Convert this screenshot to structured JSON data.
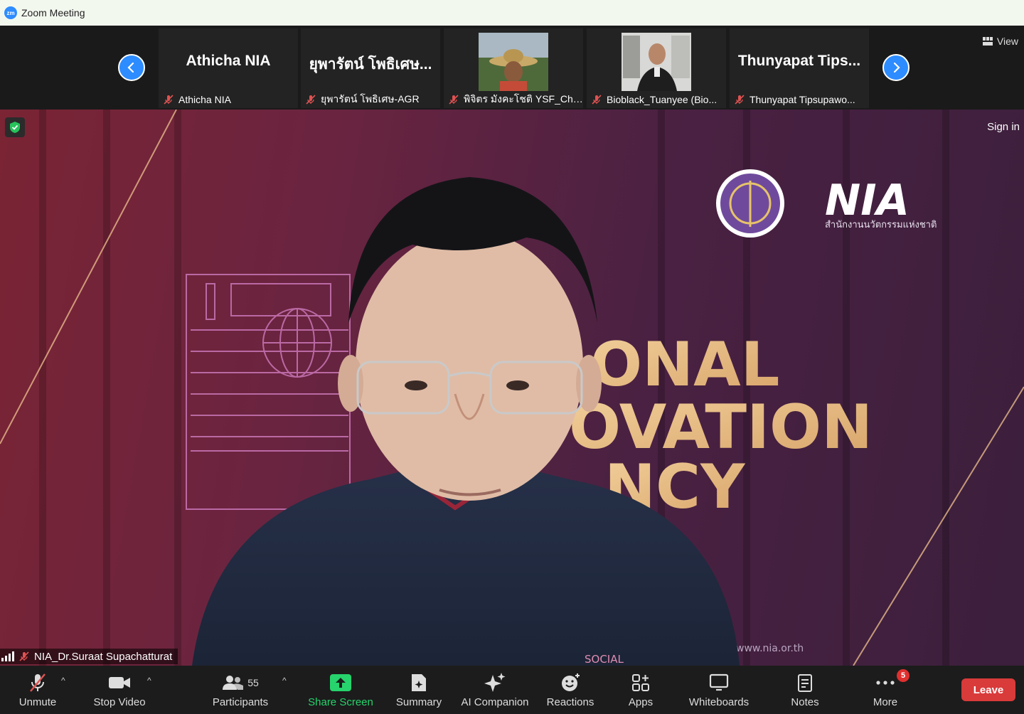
{
  "window": {
    "title": "Zoom Meeting",
    "logo_text": "zm"
  },
  "strip": {
    "view_label": "View",
    "tiles": [
      {
        "big_name": "Athicha NIA",
        "label": "Athicha NIA"
      },
      {
        "big_name": "ยุพารัตน์ โพธิเศษ...",
        "label": "ยุพารัตน์ โพธิเศษ-AGR"
      },
      {
        "big_name": "",
        "label": "พิจิตร มังคะโชติ YSF_Chi..."
      },
      {
        "big_name": "",
        "label": "Bioblack_Tuanyee (Bio..."
      },
      {
        "big_name": "Thunyapat  Tips...",
        "label": "Thunyapat Tipsupawo..."
      }
    ]
  },
  "main": {
    "sign_in": "Sign in",
    "speaker_name": "NIA_Dr.Suraat Supachatturat",
    "banner": {
      "logo_text": "NIA",
      "logo_subtitle": "สำนักงานนวัตกรรมแห่งชาติ",
      "headline_line1": "ONAL",
      "headline_line2": "OVATION",
      "headline_line3": "NCY",
      "website": "www.nia.or.th",
      "shirt_logo": "SOCIAL"
    }
  },
  "toolbar": {
    "unmute": "Unmute",
    "stop_video": "Stop Video",
    "participants": "Participants",
    "participants_count": "55",
    "share_screen": "Share Screen",
    "summary": "Summary",
    "ai_companion": "AI Companion",
    "reactions": "Reactions",
    "apps": "Apps",
    "whiteboards": "Whiteboards",
    "notes": "Notes",
    "more": "More",
    "more_badge": "5",
    "leave": "Leave"
  },
  "colors": {
    "accent": "#2d8cff",
    "leave": "#d93a3a",
    "share": "#27d36c",
    "muted": "#e05252"
  }
}
